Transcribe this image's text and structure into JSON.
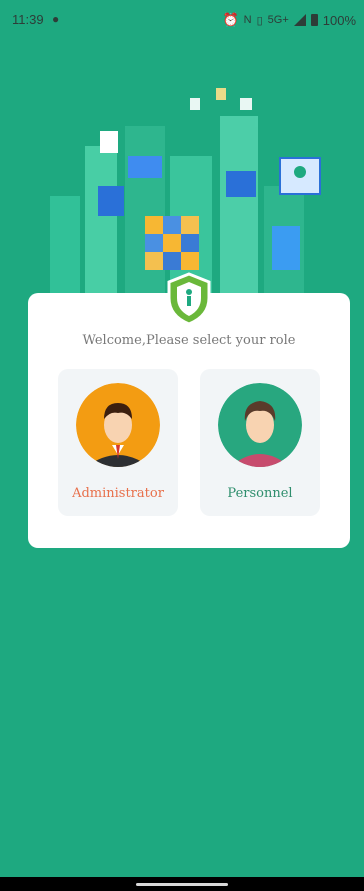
{
  "status_bar": {
    "time": "11:39",
    "network": "5G+",
    "battery": "100%",
    "icons": [
      "wechat-icon",
      "alarm-icon",
      "nfc-icon",
      "vibrate-icon",
      "signal-icon",
      "battery-icon"
    ]
  },
  "welcome_text": "Welcome,Please select your role",
  "roles": [
    {
      "label": "Administrator",
      "avatar": "administrator-avatar",
      "color": "#e8704b"
    },
    {
      "label": "Personnel",
      "avatar": "personnel-avatar",
      "color": "#2f8e6d"
    }
  ],
  "colors": {
    "background": "#1ea980",
    "card": "#ffffff",
    "tile": "#f2f5f7",
    "shield": "#6ab83a"
  }
}
